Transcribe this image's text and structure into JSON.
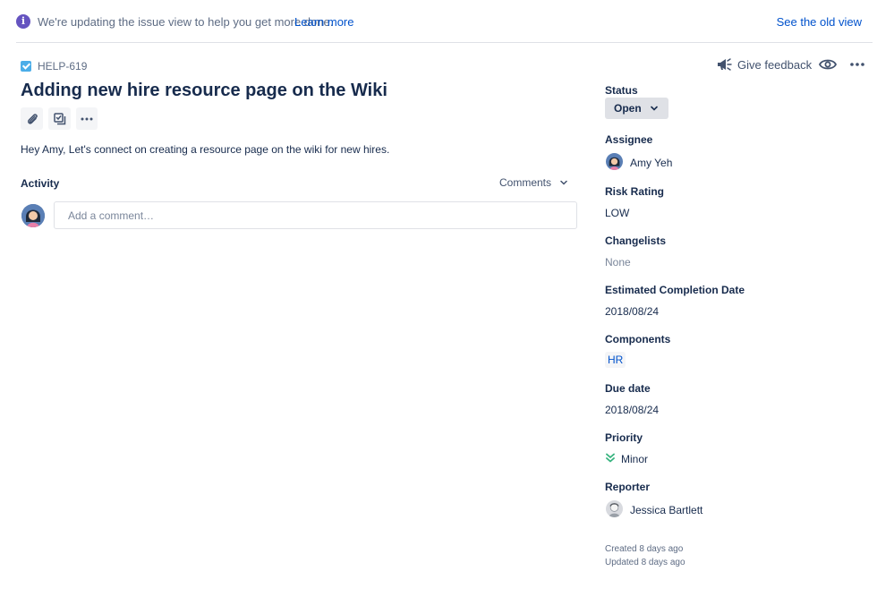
{
  "banner": {
    "info_icon": "info-icon",
    "message": "We're updating the issue view to help you get more done.",
    "learn_more": "Learn more",
    "old_view": "See the old view"
  },
  "issue": {
    "key": "HELP-619",
    "type_icon": "task-checkbox-icon",
    "title": "Adding new hire resource page on the Wiki",
    "description": "Hey Amy, Let's connect on creating a resource page on the wiki for new hires."
  },
  "header_actions": {
    "feedback_label": "Give feedback",
    "feedback_icon": "megaphone-icon",
    "watch_icon": "eye-icon",
    "more_icon": "more-horizontal-icon"
  },
  "toolbar": {
    "attach_icon": "paperclip-icon",
    "subtask_icon": "subtask-icon",
    "more_icon": "more-horizontal-icon"
  },
  "activity": {
    "label": "Activity",
    "filter": "Comments",
    "comment_placeholder": "Add a comment…"
  },
  "sidebar": {
    "status_label": "Status",
    "status_value": "Open",
    "assignee_label": "Assignee",
    "assignee_name": "Amy Yeh",
    "risk_label": "Risk Rating",
    "risk_value": "LOW",
    "changelists_label": "Changelists",
    "changelists_value": "None",
    "ecd_label": "Estimated Completion Date",
    "ecd_value": "2018/08/24",
    "components_label": "Components",
    "components_value": "HR",
    "due_label": "Due date",
    "due_value": "2018/08/24",
    "priority_label": "Priority",
    "priority_value": "Minor",
    "priority_icon": "double-chevron-down-icon",
    "reporter_label": "Reporter",
    "reporter_name": "Jessica Bartlett",
    "created": "Created 8 days ago",
    "updated": "Updated 8 days ago"
  },
  "colors": {
    "accent": "#0052cc",
    "banner_icon": "#6554c0",
    "priority_green": "#36b37e",
    "task_blue": "#4bade8"
  }
}
